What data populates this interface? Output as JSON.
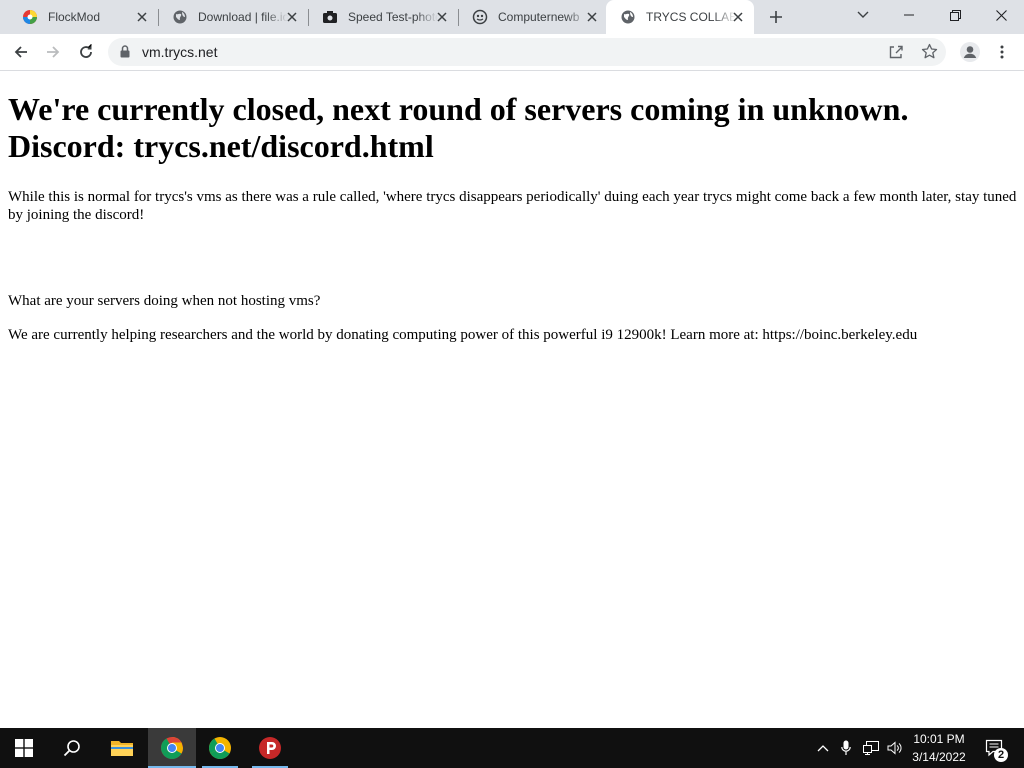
{
  "browser": {
    "tabs": [
      {
        "title": "FlockMod",
        "favicon": "flockmod-icon"
      },
      {
        "title": "Download | file.io",
        "favicon": "globe-icon"
      },
      {
        "title": "Speed Test-photo",
        "favicon": "camera-icon"
      },
      {
        "title": "Computernewb",
        "favicon": "computernewb-icon"
      },
      {
        "title": "TRYCS COLLABVM",
        "favicon": "globe-icon",
        "active": true
      }
    ],
    "url": "vm.trycs.net"
  },
  "page": {
    "heading": "We're currently closed, next round of servers coming in unknown. Discord: trycs.net/discord.html",
    "paragraph1": "While this is normal for trycs's vms as there was a rule called, 'where trycs disappears periodically' duing each year trycs might come back a few month later, stay tuned by joining the discord!",
    "question": "What are your servers doing when not hosting vms?",
    "answer": "We are currently helping researchers and the world by donating computing power of this powerful i9 12900k! Learn more at: https://boinc.berkeley.edu"
  },
  "taskbar": {
    "time": "10:01 PM",
    "date": "3/14/2022",
    "notification_count": "2"
  },
  "colors": {
    "tabbar": "#dee1e6",
    "taskbar": "#101010",
    "chrome_red": "#db4437",
    "chrome_green": "#0f9d58",
    "chrome_yellow": "#f4b400",
    "chrome_blue": "#4285f4",
    "psiphon_red": "#c62828"
  }
}
